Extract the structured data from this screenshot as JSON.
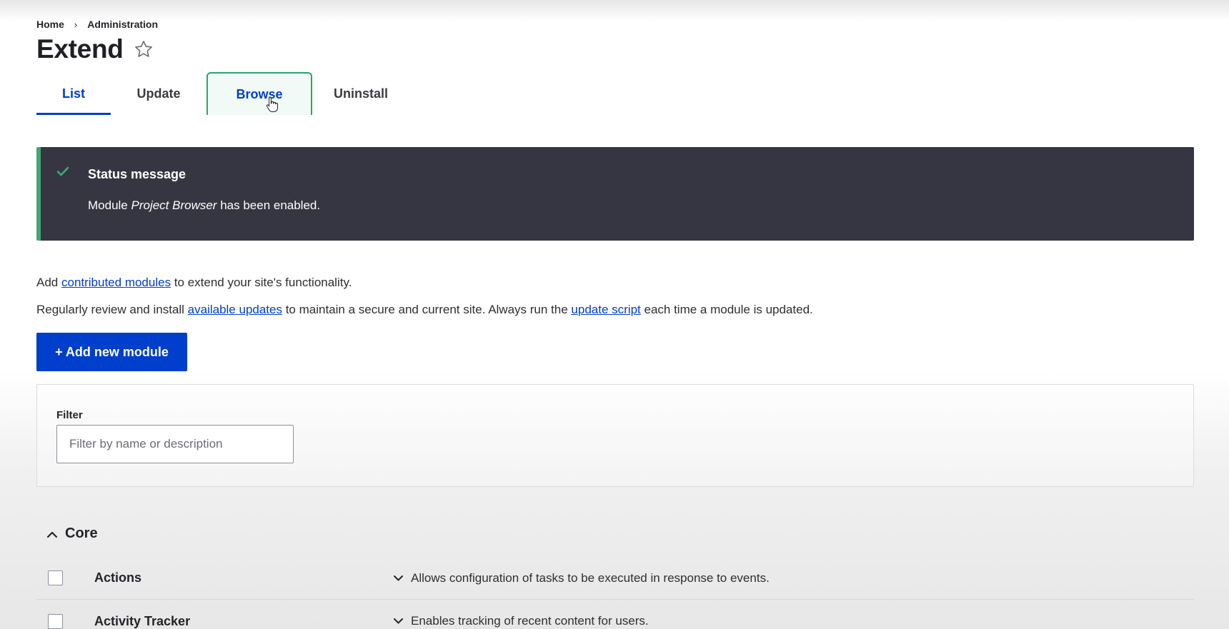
{
  "breadcrumb": {
    "home": "Home",
    "separator": "›",
    "admin": "Administration"
  },
  "page": {
    "title": "Extend",
    "favorite_icon": "star-outline-icon"
  },
  "tabs": [
    {
      "label": "List",
      "active": true
    },
    {
      "label": "Update"
    },
    {
      "label": "Browse",
      "hovered": true
    },
    {
      "label": "Uninstall"
    }
  ],
  "status": {
    "title": "Status message",
    "prefix": "Module ",
    "module": "Project Browser",
    "suffix": " has been enabled.",
    "icon": "check-icon"
  },
  "intro": {
    "line1_before": "Add ",
    "line1_link": "contributed modules",
    "line1_after": " to extend your site's functionality.",
    "line2_before": "Regularly review and install ",
    "line2_link1": "available updates",
    "line2_middle": " to maintain a secure and current site. Always run the ",
    "line2_link2": "update script",
    "line2_after": " each time a module is updated."
  },
  "add_button": {
    "label": "+ Add new module"
  },
  "filter": {
    "label": "Filter",
    "placeholder": "Filter by name or description",
    "value": ""
  },
  "core": {
    "heading": "Core",
    "modules": [
      {
        "name": "Actions",
        "description": "Allows configuration of tasks to be executed in response to events."
      },
      {
        "name": "Activity Tracker",
        "description": "Enables tracking of recent content for users."
      }
    ]
  },
  "colors": {
    "accent": "#003ecc",
    "status_bg": "#353641",
    "status_border": "#42a877",
    "browse_border": "#26a769"
  }
}
